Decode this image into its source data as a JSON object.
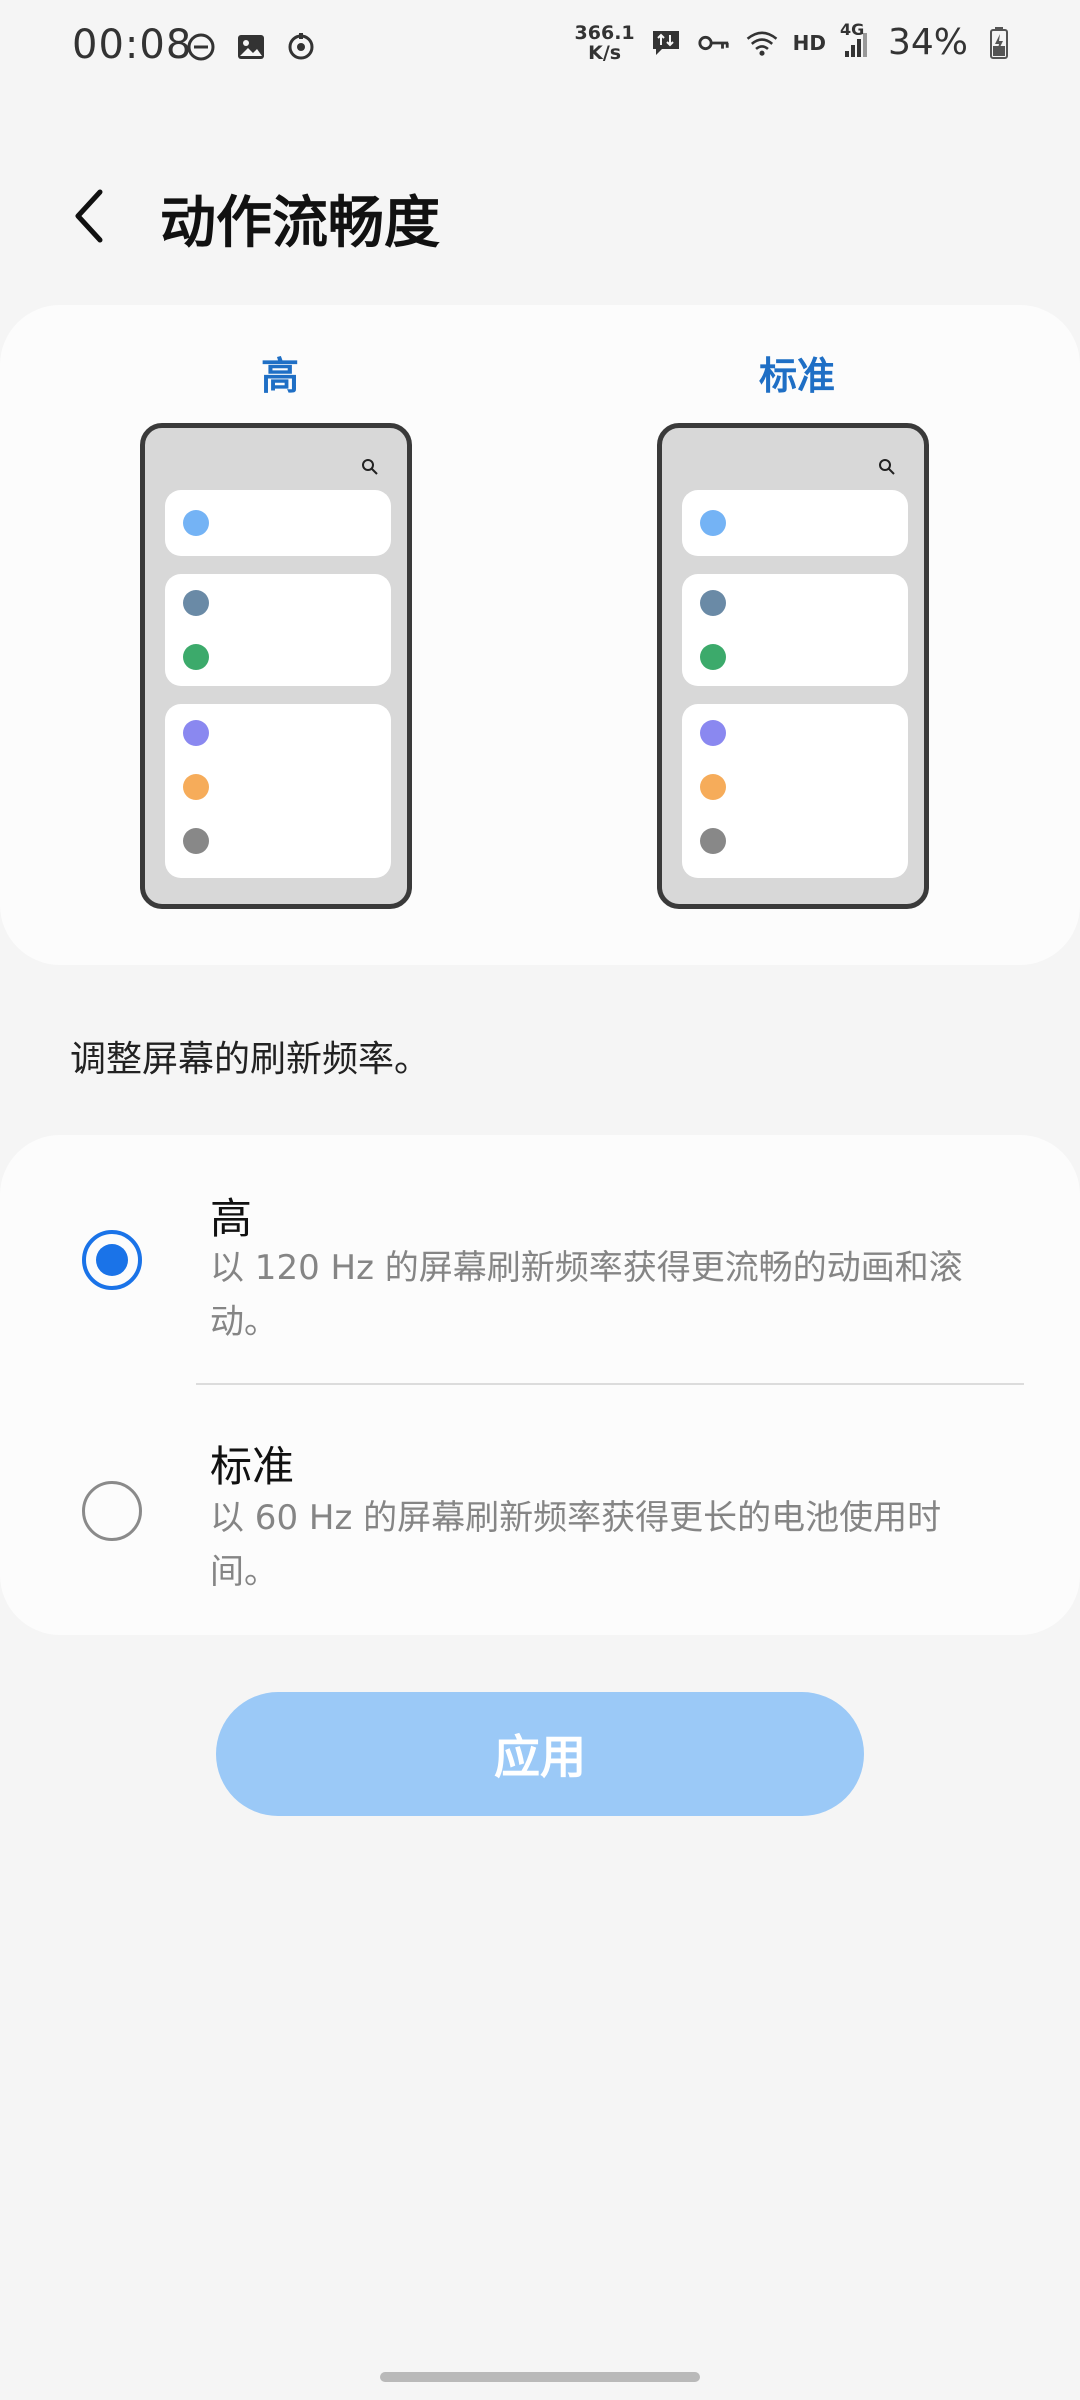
{
  "status_bar": {
    "time": "00:08",
    "net_speed_value": "366.1",
    "net_speed_unit": "K/s",
    "hd": "HD",
    "network": "4G",
    "battery": "34%",
    "icons": [
      "dnd-icon",
      "image-icon",
      "sync-icon",
      "data-transfer-icon",
      "vpn-key-icon",
      "wifi-icon",
      "signal-icon",
      "battery-charging-icon"
    ]
  },
  "header": {
    "title": "动作流畅度",
    "back_icon": "chevron-left-icon"
  },
  "preview": {
    "high_label": "高",
    "standard_label": "标准",
    "dot_colors": [
      "#74b3f5",
      "#6a8aa6",
      "#3caa6b",
      "#8a88f0",
      "#f6ac5a",
      "#888888"
    ]
  },
  "description": "调整屏幕的刷新频率。",
  "options": [
    {
      "title": "高",
      "subtitle": "以 120 Hz 的屏幕刷新频率获得更流畅的动画和滚动。",
      "selected": true
    },
    {
      "title": "标准",
      "subtitle": "以 60 Hz 的屏幕刷新频率获得更长的电池使用时间。",
      "selected": false
    }
  ],
  "apply_button": {
    "label": "应用"
  },
  "colors": {
    "accent": "#1a73e8",
    "preview_label": "#1f6fc5",
    "apply_disabled": "#9bc9f7"
  }
}
